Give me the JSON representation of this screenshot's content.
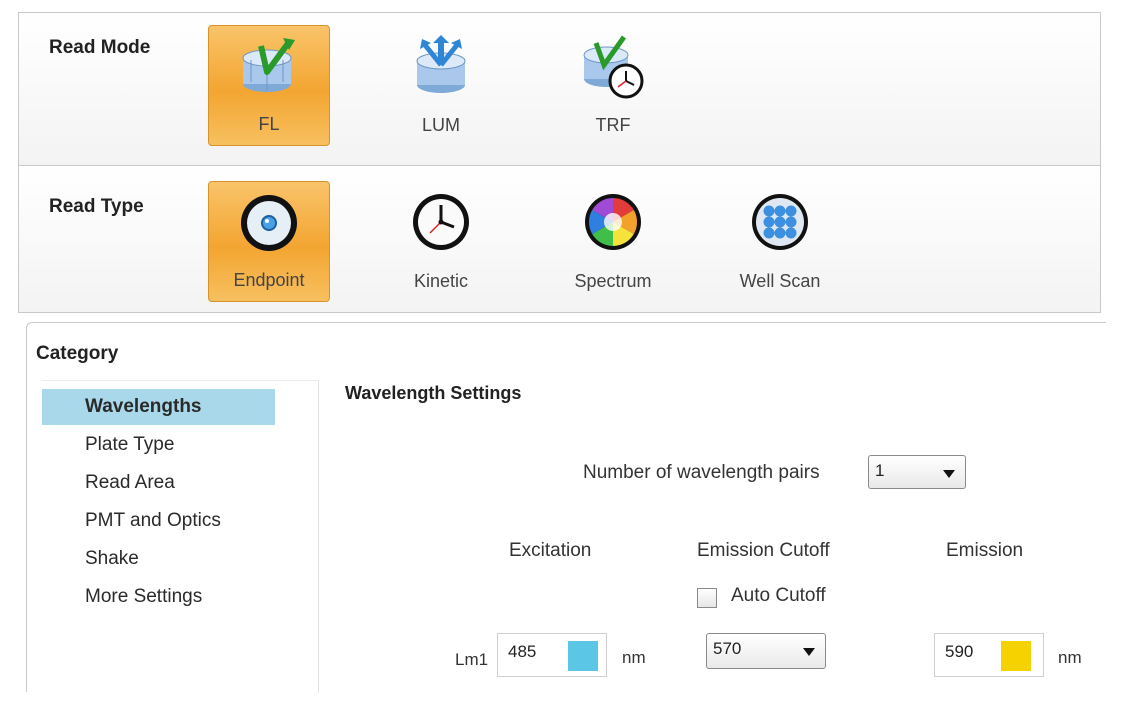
{
  "read_mode": {
    "label": "Read Mode",
    "options": [
      {
        "label": "FL",
        "icon": "fluorescence-icon",
        "selected": true
      },
      {
        "label": "LUM",
        "icon": "luminescence-icon",
        "selected": false
      },
      {
        "label": "TRF",
        "icon": "time-resolved-fluorescence-icon",
        "selected": false
      }
    ]
  },
  "read_type": {
    "label": "Read Type",
    "options": [
      {
        "label": "Endpoint",
        "icon": "endpoint-icon",
        "selected": true
      },
      {
        "label": "Kinetic",
        "icon": "clock-icon",
        "selected": false
      },
      {
        "label": "Spectrum",
        "icon": "spectrum-icon",
        "selected": false
      },
      {
        "label": "Well Scan",
        "icon": "well-scan-icon",
        "selected": false
      }
    ]
  },
  "category": {
    "title": "Category",
    "items": [
      "Wavelengths",
      "Plate Type",
      "Read Area",
      "PMT and Optics",
      "Shake",
      "More Settings"
    ],
    "active": "Wavelengths"
  },
  "wavelength_settings": {
    "title": "Wavelength Settings",
    "pairs_label": "Number of wavelength pairs",
    "pairs_value": "1",
    "excitation_header": "Excitation",
    "emission_cutoff_header": "Emission Cutoff",
    "emission_header": "Emission",
    "auto_cutoff_label": "Auto Cutoff",
    "auto_cutoff_checked": false,
    "row_label": "Lm1",
    "excitation_value": "485",
    "excitation_unit": "nm",
    "excitation_color": "#5bc6e6",
    "cutoff_value": "570",
    "emission_value": "590",
    "emission_unit": "nm",
    "emission_color": "#f6d200"
  },
  "colors": {
    "selected_tile": "#f3a531",
    "active_category": "#a9d8ea"
  }
}
